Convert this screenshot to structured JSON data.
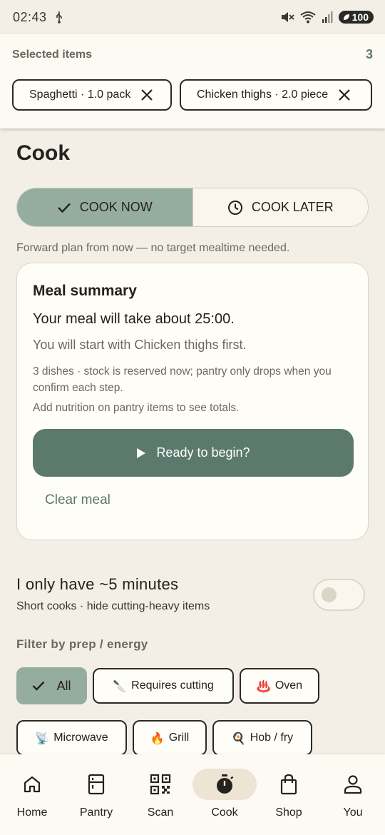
{
  "status_bar": {
    "time": "02:43",
    "battery": "100"
  },
  "selected": {
    "title": "Selected items",
    "count": "3",
    "chips": [
      {
        "label": "Spaghetti · 1.0 pack"
      },
      {
        "label": "Chicken thighs · 2.0 piece"
      }
    ]
  },
  "page": {
    "title": "Cook"
  },
  "mode": {
    "now_label": "COOK NOW",
    "later_label": "COOK LATER",
    "selected": "now"
  },
  "hint": "Forward plan from now — no target mealtime needed.",
  "summary": {
    "title": "Meal summary",
    "duration_line": "Your meal will take about 25:00.",
    "start_line": "You will start with Chicken thighs first.",
    "dishes_line": "3 dishes · stock is reserved now; pantry only drops when you confirm each step.",
    "nutrition_line": "Add nutrition on pantry items to see totals.",
    "begin_label": "Ready to begin?",
    "clear_label": "Clear meal"
  },
  "quick": {
    "label": "I only have ~5 minutes",
    "sub": "Short cooks · hide cutting-heavy items",
    "enabled": false
  },
  "filters": {
    "label": "Filter by prep / energy",
    "chips": [
      {
        "label": "All",
        "icon": "check-icon",
        "selected": true
      },
      {
        "label": "Requires cutting",
        "icon": "knife-icon",
        "emoji": "🔪"
      },
      {
        "label": "Oven",
        "icon": "hot-springs-icon",
        "emoji": "♨️"
      },
      {
        "label": "Microwave",
        "icon": "satellite-dish-icon",
        "emoji": "📡"
      },
      {
        "label": "Grill",
        "icon": "fire-icon",
        "emoji": "🔥"
      },
      {
        "label": "Hob / fry",
        "icon": "frying-pan-icon",
        "emoji": "🍳"
      }
    ]
  },
  "nav": {
    "items": [
      {
        "label": "Home",
        "icon": "home-icon"
      },
      {
        "label": "Pantry",
        "icon": "pantry-icon"
      },
      {
        "label": "Scan",
        "icon": "qr-scan-icon"
      },
      {
        "label": "Cook",
        "icon": "timer-icon",
        "active": true
      },
      {
        "label": "Shop",
        "icon": "shopping-bag-icon"
      },
      {
        "label": "You",
        "icon": "person-icon"
      }
    ]
  },
  "colors": {
    "accent": "#5b7a6d",
    "accent_light": "#95ad9f",
    "background": "#f3efe7",
    "surface": "#fffdf7"
  }
}
